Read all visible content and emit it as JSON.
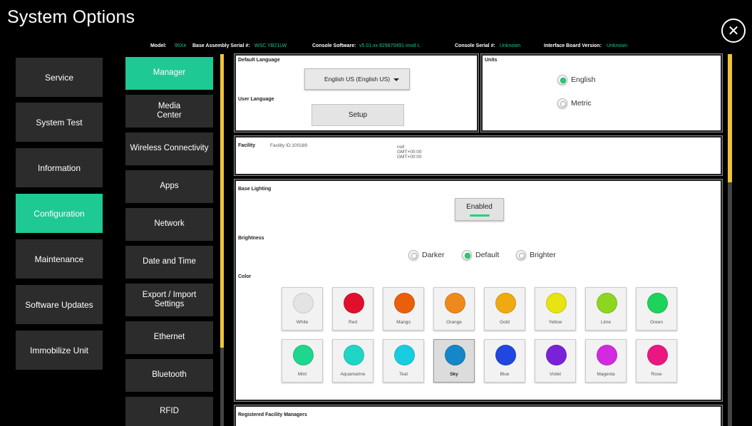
{
  "window": {
    "title": "System Options",
    "close_icon": "close-icon"
  },
  "infobar": {
    "model_label": "Model:",
    "model_value": "95Xe",
    "base_serial_label": "Base Assembly Serial #:",
    "base_serial_value": "WSC YB21LW",
    "console_sw_label": "Console Software:",
    "console_sw_value": "v5.01.xx 829870491 imx8 L",
    "console_serial_label": "Console Serial #:",
    "console_serial_value": "Unknown",
    "iface_label": "Interface Board Version:",
    "iface_value": "Unknown"
  },
  "main_menu": [
    {
      "label": "Service",
      "active": false
    },
    {
      "label": "System Test",
      "active": false
    },
    {
      "label": "Information",
      "active": false
    },
    {
      "label": "Configuration",
      "active": true
    },
    {
      "label": "Maintenance",
      "active": false
    },
    {
      "label": "Software Updates",
      "active": false
    },
    {
      "label": "Immobilize Unit",
      "active": false
    }
  ],
  "sub_menu": [
    {
      "label": "Manager",
      "active": true
    },
    {
      "label": "Media\nCenter",
      "active": false
    },
    {
      "label": "Wireless Connectivity",
      "active": false
    },
    {
      "label": "Apps",
      "active": false
    },
    {
      "label": "Network",
      "active": false
    },
    {
      "label": "Date and Time",
      "active": false
    },
    {
      "label": "Export / Import\nSettings",
      "active": false
    },
    {
      "label": "Ethernet",
      "active": false
    },
    {
      "label": "Bluetooth",
      "active": false
    },
    {
      "label": "RFID",
      "active": false
    }
  ],
  "language": {
    "default_label": "Default Language",
    "dropdown_value": "English US (English US)",
    "user_label": "User Language",
    "setup_label": "Setup"
  },
  "units": {
    "label": "Units",
    "options": [
      {
        "label": "English",
        "selected": true
      },
      {
        "label": "Metric",
        "selected": false
      }
    ]
  },
  "facility": {
    "label": "Facility",
    "id_text": "Facility ID:100189",
    "info_lines": [
      "null",
      "GMT+00:00",
      "GMT+00:00"
    ]
  },
  "lighting": {
    "label": "Base Lighting",
    "enabled_label": "Enabled",
    "enabled_color": "#22d37a",
    "brightness_label": "Brightness",
    "brightness_options": [
      {
        "label": "Darker",
        "selected": false
      },
      {
        "label": "Default",
        "selected": true
      },
      {
        "label": "Brighter",
        "selected": false
      }
    ],
    "color_label": "Color",
    "colors": [
      {
        "name": "White",
        "hex": "#e4e4e4",
        "selected": false
      },
      {
        "name": "Red",
        "hex": "#e0102c",
        "selected": false
      },
      {
        "name": "Mango",
        "hex": "#ea5f0c",
        "selected": false
      },
      {
        "name": "Orange",
        "hex": "#ee8a1c",
        "selected": false
      },
      {
        "name": "Gold",
        "hex": "#eeaa10",
        "selected": false
      },
      {
        "name": "Yellow",
        "hex": "#e8e312",
        "selected": false
      },
      {
        "name": "Lime",
        "hex": "#8cd620",
        "selected": false
      },
      {
        "name": "Green",
        "hex": "#1ed35a",
        "selected": false
      },
      {
        "name": "Mint",
        "hex": "#1ed68e",
        "selected": false
      },
      {
        "name": "Aquamarine",
        "hex": "#1fd6c6",
        "selected": false
      },
      {
        "name": "Teal",
        "hex": "#18cde0",
        "selected": false
      },
      {
        "name": "Sky",
        "hex": "#1586c8",
        "selected": true
      },
      {
        "name": "Blue",
        "hex": "#2246e0",
        "selected": false
      },
      {
        "name": "Violet",
        "hex": "#7a22d8",
        "selected": false
      },
      {
        "name": "Magenta",
        "hex": "#d22ae0",
        "selected": false
      },
      {
        "name": "Rose",
        "hex": "#ec1682",
        "selected": false
      }
    ]
  },
  "managers": {
    "label": "Registered Facility Managers"
  },
  "theme": {
    "accent": "#1ec993",
    "scroll": "#f0c33a"
  }
}
